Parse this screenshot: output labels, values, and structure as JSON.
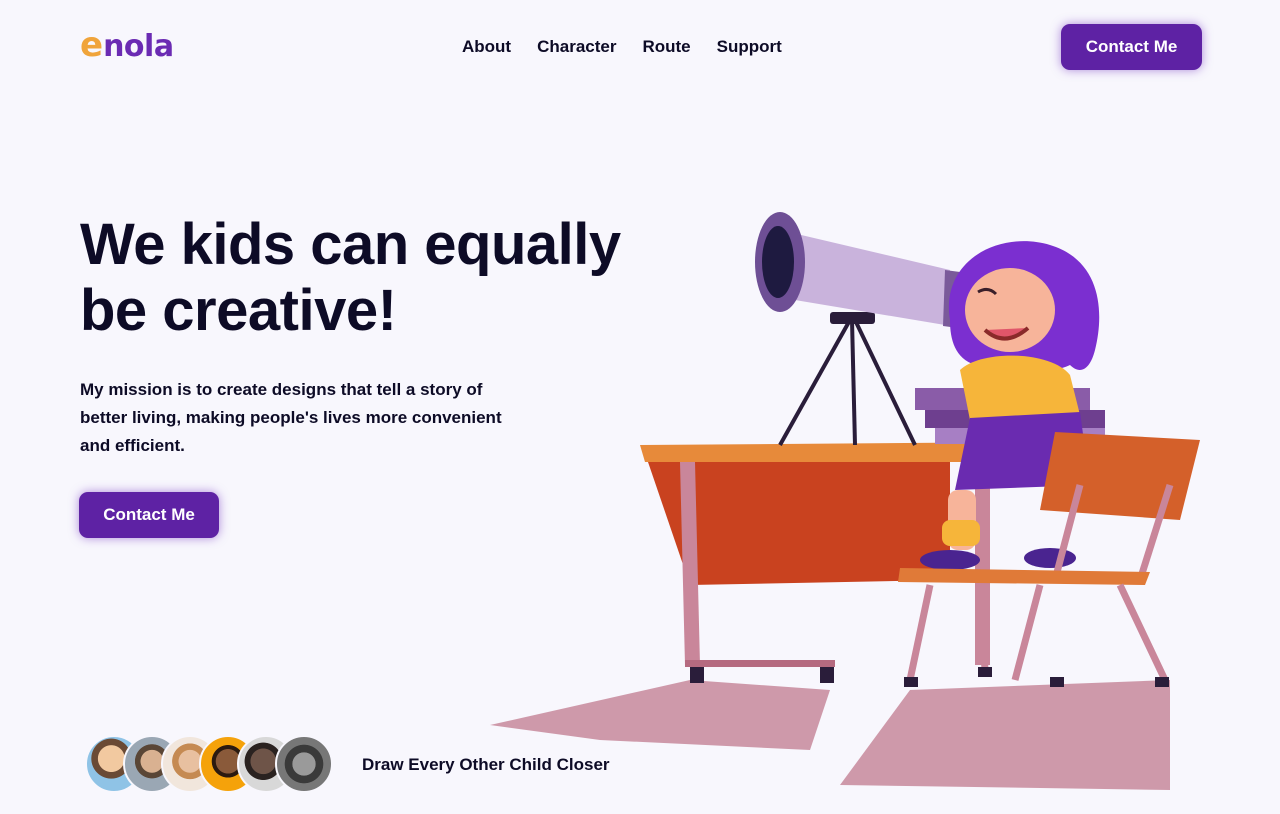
{
  "nav": {
    "logo_first": "e",
    "logo_rest": "nola",
    "items": [
      {
        "label": "About"
      },
      {
        "label": "Character"
      },
      {
        "label": "Route"
      },
      {
        "label": "Support"
      }
    ],
    "cta_label": "Contact Me"
  },
  "hero": {
    "headline_line1": "We kids can equally",
    "headline_line2": "be creative!",
    "mission": "My mission is to create designs that tell a story of better living, making people's lives more convenient and efficient.",
    "cta_label": "Contact Me"
  },
  "footer": {
    "tagline": "Draw Every Other Child Closer",
    "avatar_count": 6
  },
  "colors": {
    "brand_purple": "#5e22a4",
    "logo_orange": "#f0a43b",
    "text_dark": "#0d0b26",
    "background": "#f8f7fd"
  }
}
